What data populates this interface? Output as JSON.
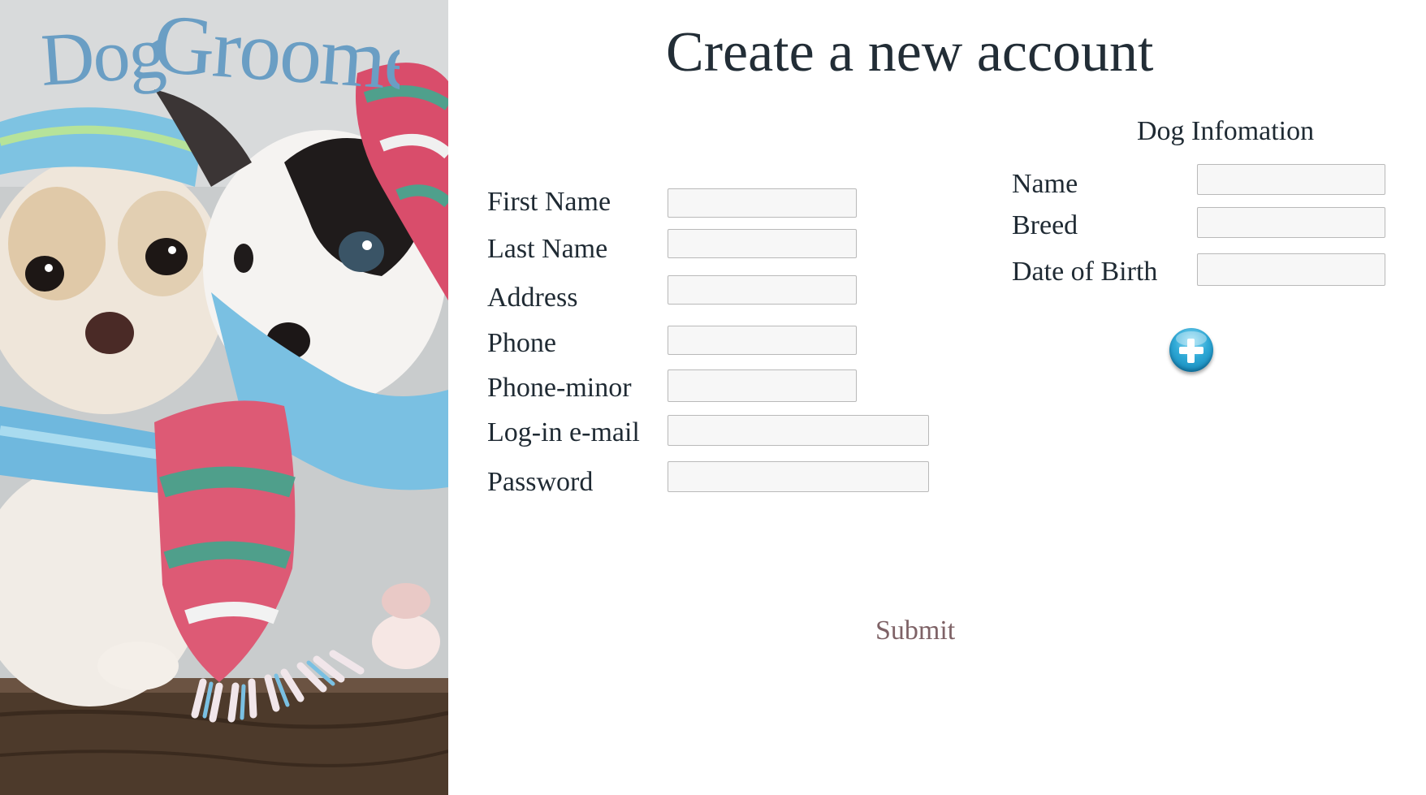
{
  "brand": {
    "title": "Dog Groomer",
    "color": "#6a9ec4"
  },
  "page": {
    "title": "Create a new account"
  },
  "owner_form": {
    "first_name": {
      "label": "First Name",
      "value": ""
    },
    "last_name": {
      "label": "Last Name",
      "value": ""
    },
    "address": {
      "label": "Address",
      "value": ""
    },
    "phone": {
      "label": "Phone",
      "value": ""
    },
    "phone_minor": {
      "label": "Phone-minor",
      "value": ""
    },
    "login_email": {
      "label": "Log-in e-mail",
      "value": ""
    },
    "password": {
      "label": "Password",
      "value": ""
    }
  },
  "dog_form": {
    "heading": "Dog Infomation",
    "name": {
      "label": "Name",
      "value": ""
    },
    "breed": {
      "label": "Breed",
      "value": ""
    },
    "date_of_birth": {
      "label": "Date of Birth",
      "value": ""
    },
    "add_icon": "plus-circle-icon"
  },
  "actions": {
    "submit_label": "Submit"
  },
  "colors": {
    "submit_text": "#7e6266",
    "accent_blue": "#2fa9d6"
  }
}
